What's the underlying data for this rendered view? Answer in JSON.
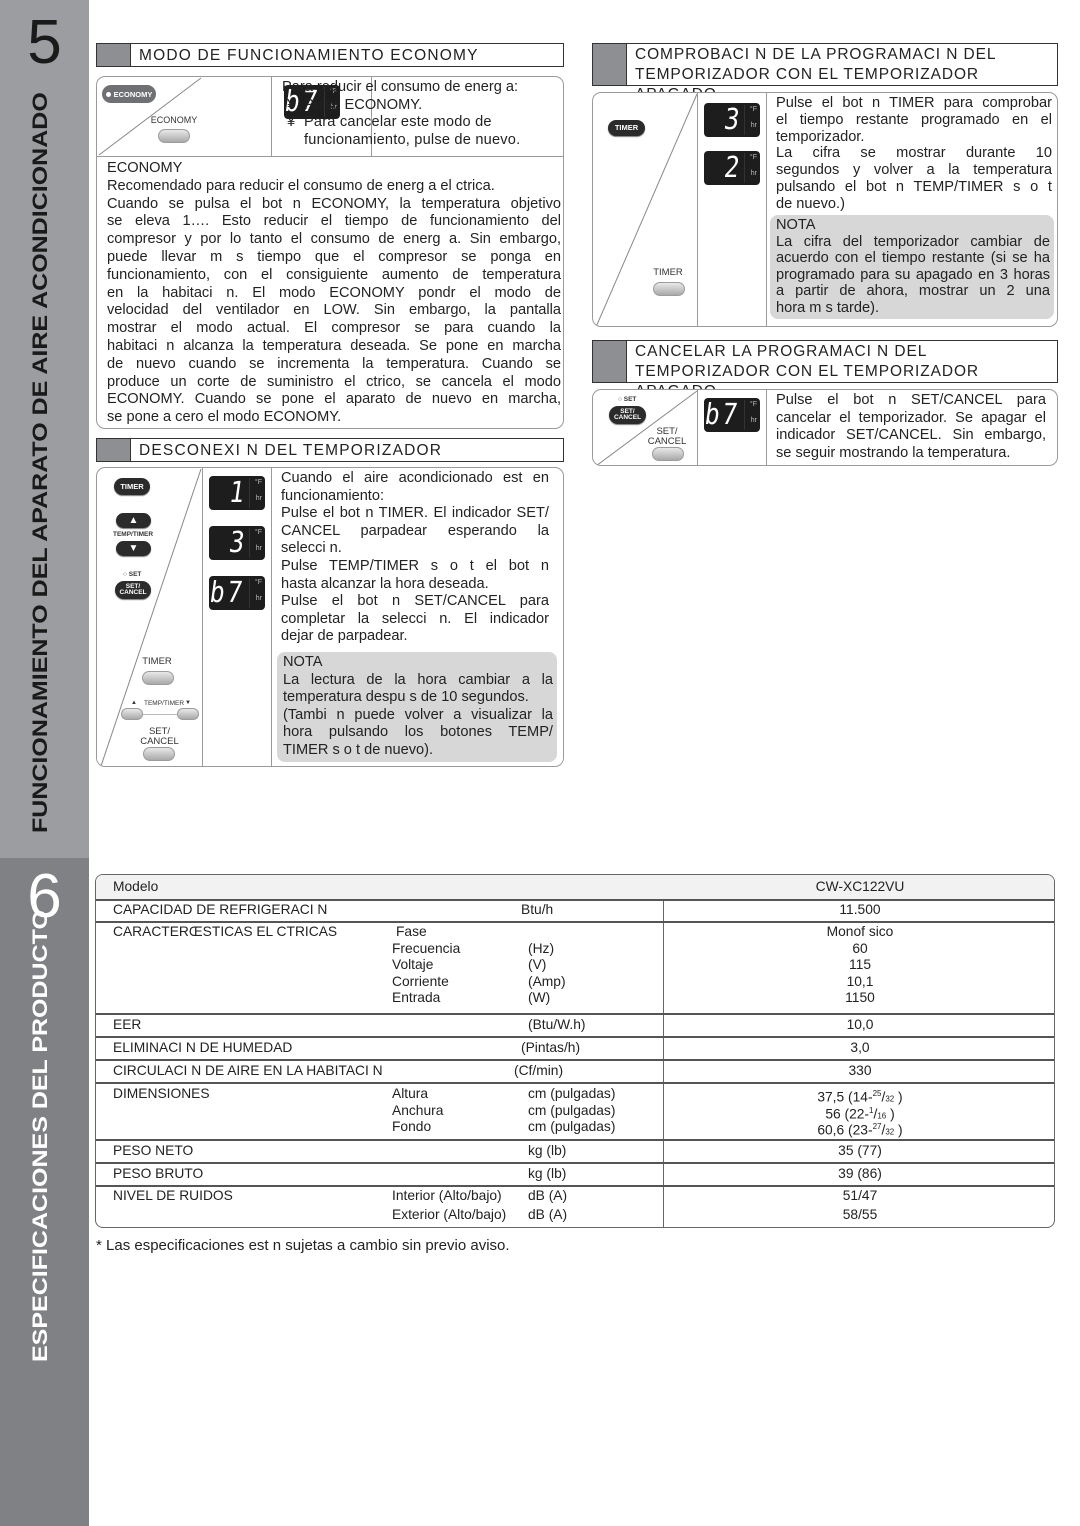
{
  "sidebar": {
    "section5_number": "5",
    "section5_title": "FUNCIONAMIENTO DEL APARATO DE AIRE ACONDICIONADO",
    "section6_number": "6",
    "section6_title": "ESPECIFICACIONES DEL PRODUCTO"
  },
  "economy": {
    "header": "MODO DE FUNCIONAMIENTO ECONOMY",
    "remote_button": "ECONOMY",
    "unit_button_label": "ECONOMY",
    "display": {
      "digits": "b7",
      "unit_top": "°F",
      "unit_bottom": "hr"
    },
    "intro": "Para reducir el consumo de energ a:",
    "bullets": [
      {
        "mark": "¥",
        "text": "Pulse ECONOMY."
      },
      {
        "mark": "¥",
        "text": "Para cancelar este modo de funcionamiento, pulse de nuevo."
      }
    ],
    "note_title": "ECONOMY",
    "note_lines": [
      "Recomendado para reducir el consumo de energ a el ctrica.",
      "Cuando se pulsa el bot n ECONOMY, la temperatura objetivo",
      "se eleva 1…. Esto reducir  el tiempo de funcionamiento del",
      "compresor y por lo tanto el consumo de energ a. Sin embargo,",
      "puede llevar m s tiempo que el compresor se ponga en",
      "funcionamiento, con el consiguiente aumento de temperatura",
      "en la habitaci n. El modo ECONOMY pondr  el modo de",
      "velocidad del ventilador en LOW. Sin embargo, la pantalla",
      "mostrar  el modo actual. El compresor se para cuando la",
      "habitaci n alcanza la temperatura deseada. Se pone en marcha",
      "de nuevo cuando se incrementa la temperatura. Cuando se",
      "produce un corte de suministro el ctrico, se cancela el modo",
      "ECONOMY. Cuando se pone el aparato de nuevo en marcha,",
      "se pone a cero el modo ECONOMY."
    ]
  },
  "timer_off": {
    "header": "DESCONEXI   N DEL TEMPORIZADOR",
    "remote": {
      "timer": "TIMER",
      "up": "▲",
      "temp_timer": "TEMP/TIMER",
      "down": "▼",
      "set_indicator": "SET",
      "set_cancel": "SET/ CANCEL"
    },
    "unit": {
      "timer": "TIMER",
      "temp_timer": "TEMP/TIMER",
      "set_cancel_1": "SET/",
      "set_cancel_2": "CANCEL",
      "up": "▲",
      "down": "▼"
    },
    "displays": [
      {
        "digits": "1",
        "unit_top": "°F",
        "unit_bottom": "hr"
      },
      {
        "digits": "3",
        "unit_top": "°F",
        "unit_bottom": "hr"
      },
      {
        "digits": "b7",
        "unit_top": "°F",
        "unit_bottom": "hr"
      }
    ],
    "lines": [
      "Cuando el aire acondicionado est  en",
      "funcionamiento:",
      "Pulse el bot n TIMER. El indicador SET/",
      "CANCEL parpadear  esperando la",
      "selecci n.",
      "Pulse TEMP/TIMER s  o t   el bot n",
      "hasta alcanzar la hora deseada.",
      "Pulse el bot n SET/CANCEL para",
      "completar la selecci n. El indicador",
      "dejar  de parpadear."
    ],
    "note_title": "NOTA",
    "note_lines": [
      "La lectura de la hora cambiar  a la",
      "temperatura despu s de 10 segundos.",
      "(Tambi n puede volver a visualizar la",
      "hora pulsando los botones TEMP/",
      "TIMER s  o t   de nuevo)."
    ]
  },
  "check_timer": {
    "header_1": "COMPROBACI   N DE LA PROGRAMACI   N DEL",
    "header_2": "TEMPORIZADOR CON EL TEMPORIZADOR APAGADO",
    "remote_button": "TIMER",
    "unit_button_label": "TIMER",
    "displays": [
      {
        "digits": "3",
        "unit_top": "°F",
        "unit_bottom": "hr"
      },
      {
        "digits": "2",
        "unit_top": "°F",
        "unit_bottom": "hr"
      }
    ],
    "lines": [
      "Pulse el bot n TIMER para comprobar",
      "el tiempo restante programado en el",
      "temporizador.",
      "La cifra se mostrar  durante 10",
      "segundos y volver  a la temperatura",
      "pulsando el bot n TEMP/TIMER s  o t",
      "de nuevo.)"
    ],
    "note_title": "NOTA",
    "note_lines": [
      "La cifra del temporizador cambiar  de",
      "acuerdo con el tiempo restante (si se ha",
      "programado para su apagado en 3 horas",
      "a partir de ahora, mostrar  un 2 una",
      "hora m s tarde)."
    ]
  },
  "cancel_timer": {
    "header_1": "CANCELAR LA PROGRAMACI   N DEL",
    "header_2": "TEMPORIZADOR CON EL TEMPORIZADOR APAGADO",
    "remote_indicator": "SET",
    "remote_button": "SET/ CANCEL",
    "unit_label_1": "SET/",
    "unit_label_2": "CANCEL",
    "display": {
      "digits": "b7",
      "unit_top": "°F",
      "unit_bottom": "hr"
    },
    "lines": [
      "Pulse el bot n SET/CANCEL para",
      "cancelar el temporizador. Se apagar  el",
      "indicador SET/CANCEL. Sin embargo,",
      "se seguir  mostrando la temperatura."
    ]
  },
  "specs": {
    "model_label": "Modelo",
    "model_value": "CW-XC122VU",
    "cooling": {
      "label": "CAPACIDAD DE REFRIGERACI N",
      "unit": "Btu/h",
      "value": "11.500"
    },
    "electrical": {
      "label": "CARACTERŒSTICAS EL CTRICAS",
      "rows": [
        {
          "name": "Fase",
          "unit": "",
          "value": "Monof sico"
        },
        {
          "name": "Frecuencia",
          "unit": "(Hz)",
          "value": "60"
        },
        {
          "name": "Voltaje",
          "unit": "(V)",
          "value": "115"
        },
        {
          "name": "Corriente",
          "unit": "(Amp)",
          "value": "10,1"
        },
        {
          "name": "Entrada",
          "unit": "(W)",
          "value": "1150"
        }
      ]
    },
    "eer": {
      "label": "EER",
      "unit": "(Btu/W.h)",
      "value": "10,0"
    },
    "dehumid": {
      "label": "ELIMINACI N DE HUMEDAD",
      "unit": "(Pintas/h)",
      "value": "3,0"
    },
    "airflow": {
      "label": "CIRCULACI N DE AIRE EN LA HABITACI N",
      "unit": "(Cf/min)",
      "value": "330"
    },
    "dimensions": {
      "label": "DIMENSIONES",
      "rows": [
        {
          "name": "Altura",
          "unit": "cm (pulgadas)",
          "value": "37,5 (14-",
          "num": "25",
          "den": "32",
          "close": " )"
        },
        {
          "name": "Anchura",
          "unit": "cm (pulgadas)",
          "value": "56 (22-",
          "num": "1",
          "den": "16",
          "close": " )"
        },
        {
          "name": "Fondo",
          "unit": "cm (pulgadas)",
          "value": "60,6 (23-",
          "num": "27",
          "den": "32",
          "close": " )"
        }
      ]
    },
    "net_weight": {
      "label": "PESO NETO",
      "unit": "kg (lb)",
      "value": "35 (77)"
    },
    "gross_weight": {
      "label": "PESO BRUTO",
      "unit": "kg (lb)",
      "value": "39 (86)"
    },
    "noise": {
      "label": "NIVEL DE RUIDOS",
      "rows": [
        {
          "name": "Interior (Alto/bajo)",
          "unit": "dB (A)",
          "value": "51/47"
        },
        {
          "name": "Exterior (Alto/bajo)",
          "unit": "dB (A)",
          "value": "58/55"
        }
      ]
    },
    "footnote": "*  Las especificaciones est n sujetas a cambio sin previo aviso."
  }
}
